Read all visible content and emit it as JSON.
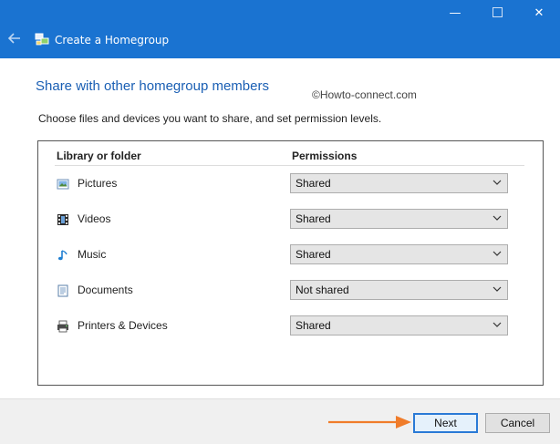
{
  "window": {
    "title": "Create a Homegroup",
    "controls": {
      "minimize_glyph": "—",
      "close_glyph": "✕"
    },
    "accent_color": "#1a73d1"
  },
  "heading": "Share with other homegroup members",
  "watermark": "©Howto-connect.com",
  "instructions": "Choose files and devices you want to share, and set permission levels.",
  "table": {
    "headers": {
      "library": "Library or folder",
      "permissions": "Permissions"
    },
    "rows": [
      {
        "label": "Pictures",
        "icon": "pictures-icon",
        "permission": "Shared"
      },
      {
        "label": "Videos",
        "icon": "videos-icon",
        "permission": "Shared"
      },
      {
        "label": "Music",
        "icon": "music-icon",
        "permission": "Shared"
      },
      {
        "label": "Documents",
        "icon": "documents-icon",
        "permission": "Not shared"
      },
      {
        "label": "Printers & Devices",
        "icon": "printer-icon",
        "permission": "Shared"
      }
    ]
  },
  "buttons": {
    "next": "Next",
    "cancel": "Cancel"
  },
  "annotation": {
    "arrow_color": "#f07c2a"
  }
}
